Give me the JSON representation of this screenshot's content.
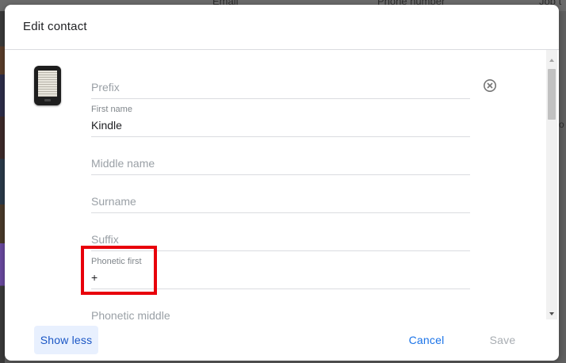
{
  "background": {
    "column_email": "Email",
    "column_phone": "Phone number",
    "column_job": "Job t",
    "right_fragment": "o"
  },
  "dialog": {
    "title": "Edit contact",
    "avatar_icon": "kindle-device-icon",
    "clear_icon": "clear-circle-icon",
    "fields": {
      "prefix": {
        "placeholder": "Prefix"
      },
      "first_name": {
        "label": "First name",
        "value": "Kindle"
      },
      "middle_name": {
        "placeholder": "Middle name"
      },
      "surname": {
        "placeholder": "Surname"
      },
      "suffix": {
        "placeholder": "Suffix"
      },
      "phonetic_first": {
        "label": "Phonetic first",
        "value": "+"
      },
      "phonetic_middle": {
        "placeholder": "Phonetic middle"
      }
    },
    "footer": {
      "show_less": "Show less",
      "cancel": "Cancel",
      "save": "Save"
    }
  },
  "colors": {
    "accent": "#1a73e8",
    "highlight": "#e8000b",
    "show_less_bg": "#e8f0fe"
  }
}
